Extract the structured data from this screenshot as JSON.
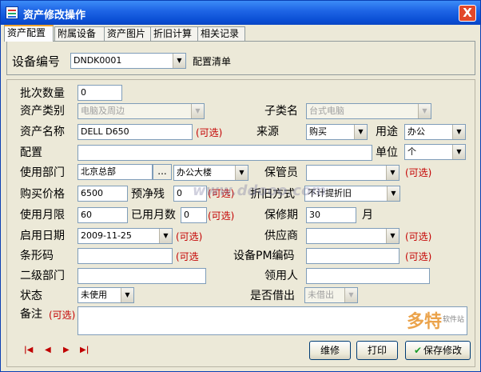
{
  "window": {
    "title": "资产修改操作",
    "close_glyph": "X"
  },
  "tabs": [
    "资产配置",
    "附属设备",
    "资产图片",
    "折旧计算",
    "相关记录"
  ],
  "top": {
    "device_no_label": "设备编号",
    "device_no_value": "DNDK0001",
    "config_list_label": "配置清单"
  },
  "form": {
    "batch_qty": {
      "label": "批次数量",
      "value": "0"
    },
    "asset_category": {
      "label": "资产类别",
      "value": "电脑及周边"
    },
    "subcategory": {
      "label": "子类名",
      "value": "台式电脑"
    },
    "asset_name": {
      "label": "资产名称",
      "value": "DELL D650",
      "optional": "(可选)"
    },
    "source": {
      "label": "来源",
      "value": "购买"
    },
    "usage": {
      "label": "用途",
      "value": "办公"
    },
    "config": {
      "label": "配置",
      "value": ""
    },
    "unit": {
      "label": "单位",
      "value": "个"
    },
    "department": {
      "label": "使用部门",
      "value": "北京总部",
      "ellipsis": "...",
      "building": "办公大楼"
    },
    "keeper": {
      "label": "保管员",
      "value": "",
      "optional": "(可选)"
    },
    "price": {
      "label": "购买价格",
      "value": "6500"
    },
    "residual": {
      "label": "预净残",
      "value": "0",
      "optional": "(可选)"
    },
    "depreciation": {
      "label": "折旧方式",
      "value": "不计提折旧"
    },
    "life_months": {
      "label": "使用月限",
      "value": "60"
    },
    "used_months": {
      "label": "已用月数",
      "value": "0",
      "optional": "(可选)"
    },
    "warranty": {
      "label": "保修期",
      "value": "30",
      "unit": "月"
    },
    "start_date": {
      "label": "启用日期",
      "value": "2009-11-25",
      "optional": "(可选)"
    },
    "supplier": {
      "label": "供应商",
      "value": "",
      "optional": "(可选)"
    },
    "barcode": {
      "label": "条形码",
      "value": "",
      "optional": "(可选"
    },
    "pm_code": {
      "label": "设备PM编码",
      "value": "",
      "optional": "(可选)"
    },
    "sub_department": {
      "label": "二级部门",
      "value": ""
    },
    "recipient": {
      "label": "领用人",
      "value": ""
    },
    "status": {
      "label": "状态",
      "value": "未使用"
    },
    "borrowed": {
      "label": "是否借出",
      "value": "未借出"
    },
    "remarks": {
      "label": "备注",
      "optional": "(可选)",
      "value": ""
    }
  },
  "nav": {
    "first": "|◀",
    "prev": "◀",
    "next": "▶",
    "last": "▶|"
  },
  "buttons": {
    "repair": "维修",
    "print": "打印",
    "save": "保存修改",
    "save_icon": "✔"
  },
  "watermark": {
    "text1": "www.ddooo.com",
    "text2": "多特",
    "text3": "软件站"
  }
}
